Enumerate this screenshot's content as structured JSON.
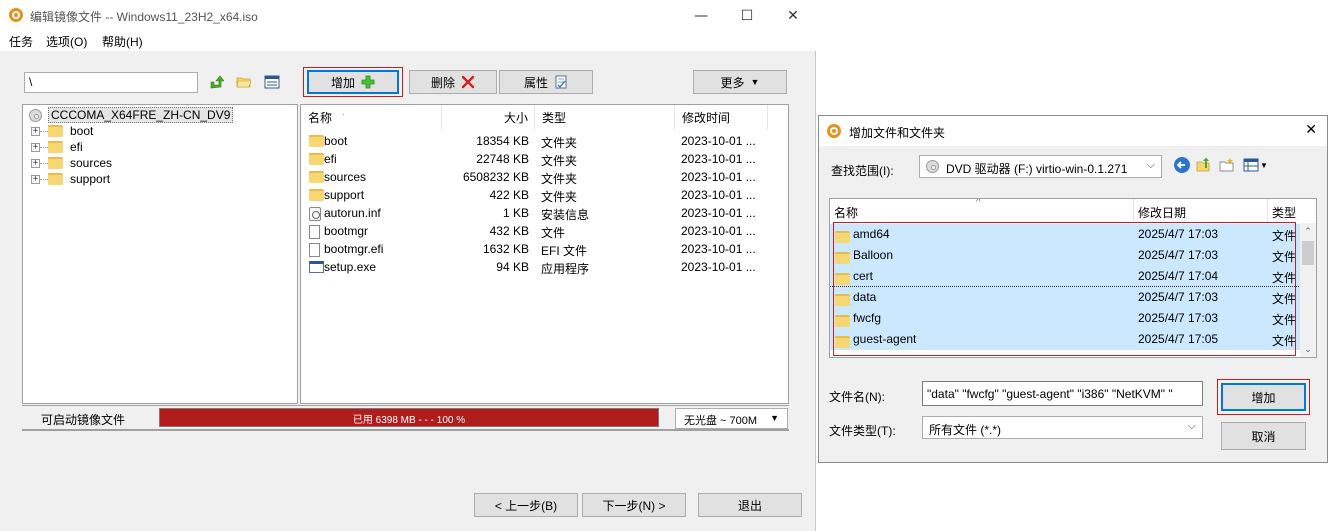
{
  "main_window": {
    "title": "编辑镜像文件 -- Windows11_23H2_x64.iso",
    "controls": {
      "minimize": "—",
      "maximize": "☐",
      "close": "✕"
    },
    "menu": [
      "任务",
      "选项(O)",
      "帮助(H)"
    ],
    "path_value": "\\",
    "toolbar": {
      "add_label": "增加",
      "delete_label": "删除",
      "properties_label": "属性",
      "more_label": "更多"
    },
    "tree": {
      "root": "CCCOMA_X64FRE_ZH-CN_DV9",
      "items": [
        "boot",
        "efi",
        "sources",
        "support"
      ]
    },
    "file_list": {
      "columns": [
        "名称",
        "大小",
        "类型",
        "修改时间"
      ],
      "rows": [
        {
          "icon": "folder",
          "name": "boot",
          "size": "18354 KB",
          "type": "文件夹",
          "date": "2023-10-01 ..."
        },
        {
          "icon": "folder",
          "name": "efi",
          "size": "22748 KB",
          "type": "文件夹",
          "date": "2023-10-01 ..."
        },
        {
          "icon": "folder",
          "name": "sources",
          "size": "6508232 KB",
          "type": "文件夹",
          "date": "2023-10-01 ..."
        },
        {
          "icon": "folder",
          "name": "support",
          "size": "422 KB",
          "type": "文件夹",
          "date": "2023-10-01 ..."
        },
        {
          "icon": "inf",
          "name": "autorun.inf",
          "size": "1 KB",
          "type": "安装信息",
          "date": "2023-10-01 ..."
        },
        {
          "icon": "doc",
          "name": "bootmgr",
          "size": "432 KB",
          "type": "文件",
          "date": "2023-10-01 ..."
        },
        {
          "icon": "doc",
          "name": "bootmgr.efi",
          "size": "1632 KB",
          "type": "EFI 文件",
          "date": "2023-10-01 ..."
        },
        {
          "icon": "exe",
          "name": "setup.exe",
          "size": "94 KB",
          "type": "应用程序",
          "date": "2023-10-01 ..."
        }
      ]
    },
    "status": {
      "label": "可启动镜像文件",
      "progress_text": "已用  6398 MB   - - -  100 %",
      "progress_fraction": 1.0,
      "disk": "无光盘 ~ 700M"
    },
    "nav": {
      "back": "< 上一步(B)",
      "next": "下一步(N) >",
      "exit": "退出"
    }
  },
  "dialog": {
    "title": "增加文件和文件夹",
    "lookin_label": "查找范围(I):",
    "lookin_value": "DVD 驱动器 (F:) virtio-win-0.1.271",
    "columns": [
      "名称",
      "修改日期",
      "类型"
    ],
    "rows": [
      {
        "name": "amd64",
        "date": "2025/4/7 17:03",
        "type": "文件"
      },
      {
        "name": "Balloon",
        "date": "2025/4/7 17:03",
        "type": "文件"
      },
      {
        "name": "cert",
        "date": "2025/4/7 17:04",
        "type": "文件"
      },
      {
        "name": "data",
        "date": "2025/4/7 17:03",
        "type": "文件"
      },
      {
        "name": "fwcfg",
        "date": "2025/4/7 17:03",
        "type": "文件"
      },
      {
        "name": "guest-agent",
        "date": "2025/4/7 17:05",
        "type": "文件"
      }
    ],
    "filename_label": "文件名(N):",
    "filename_value": "\"data\" \"fwcfg\" \"guest-agent\" \"i386\" \"NetKVM\" \"",
    "filetype_label": "文件类型(T):",
    "filetype_value": "所有文件 (*.*)",
    "add_button": "增加",
    "cancel_button": "取消"
  },
  "colors": {
    "accent": "#0078d7",
    "selection": "#cce8ff",
    "highlight_frame": "#c81e1e",
    "progress_fill": "#b01c1c",
    "folder": "#f7d774"
  }
}
